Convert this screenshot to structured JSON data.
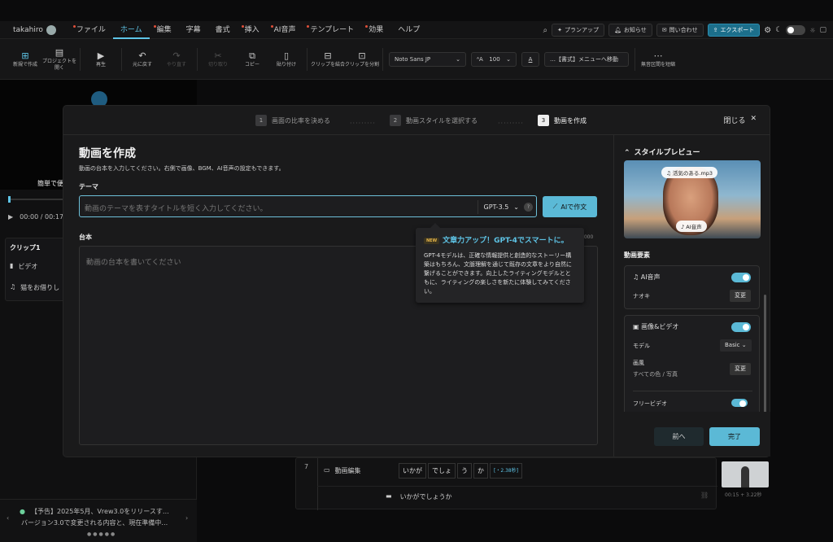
{
  "topbar": {
    "user": "takahiro",
    "menus": [
      "ファイル",
      "ホーム",
      "編集",
      "字幕",
      "書式",
      "挿入",
      "AI音声",
      "テンプレート",
      "効果",
      "ヘルプ"
    ],
    "right": {
      "plan": "プランアップ",
      "notice": "お知らせ",
      "contact": "問い合わせ",
      "export": "エクスポート"
    }
  },
  "toolbar": {
    "new": "新規で作成",
    "open": "プロジェクトを開く",
    "play": "再生",
    "undo": "元に戻す",
    "redo": "やり直す",
    "cut": "切り取り",
    "copy": "コピー",
    "paste": "貼り付け",
    "merge": "クリップを結合",
    "split": "クリップを分割",
    "font": "Noto Sans JP",
    "size": "100",
    "format_menu": "…【書式】メニューへ移動",
    "silence": "無音区間を短縮"
  },
  "left": {
    "caption_stub": "簡単で便",
    "time": "00:00 / 00:17",
    "clip_title": "クリップ1",
    "clip_video": "ビデオ",
    "clip_bgm": "猫をお借りし",
    "news_line1": "【予告】2025年5月、Vrew3.0をリリースす…",
    "news_line2": "バージョン3.0で変更される内容と、現在準備中…"
  },
  "modal": {
    "steps": [
      {
        "num": "1",
        "label": "画面の比率を決める"
      },
      {
        "num": "2",
        "label": "動画スタイルを選択する"
      },
      {
        "num": "3",
        "label": "動画を作成"
      }
    ],
    "close": "閉じる",
    "title": "動画を作成",
    "subtitle": "動画の台本を入力してください。右側で画像、BGM、AI音声の設定もできます。",
    "theme_label": "テーマ",
    "theme_placeholder": "動画のテーマを表すタイトルを短く入力してください。",
    "model": "GPT-3.5",
    "ai_button": "AIで作文",
    "script_label": "台本",
    "script_placeholder": "動画の台本を書いてください",
    "counter": "0000",
    "tooltip": {
      "badge": "NEW",
      "title": "文章力アップ！GPT-4でスマートに。",
      "body": "GPT-4モデルは、正確な情報提供と創造的なストーリー構築はもちろん、文脈理解を通じて既存の文章をより自然に繋げることができます。向上したライティングモデルとともに、ライティングの楽しさを新たに体験してみてください。"
    }
  },
  "style_preview": {
    "title": "スタイルプレビュー",
    "bgm_tag": "活気のある.mp3",
    "voice_tag": "AI音声",
    "elements_title": "動画要素",
    "ai_voice": "AI音声",
    "voice_name": "ナオキ",
    "change": "変更",
    "image_video": "画像&ビデオ",
    "model_label": "モデル",
    "model_value": "Basic",
    "style_label": "画風",
    "style_value": "すべての色 / 写真",
    "free_video": "フリービデオ",
    "prev": "前へ",
    "done": "完了"
  },
  "timeline": {
    "row_num": "7",
    "edit_label": "動画編集",
    "words": [
      "いかが",
      "でしょ",
      "う",
      "か"
    ],
    "gap": "[・2.38秒]",
    "sentence": "いかがでしょうか",
    "thumb_time": "00:15 + 3.22秒"
  }
}
